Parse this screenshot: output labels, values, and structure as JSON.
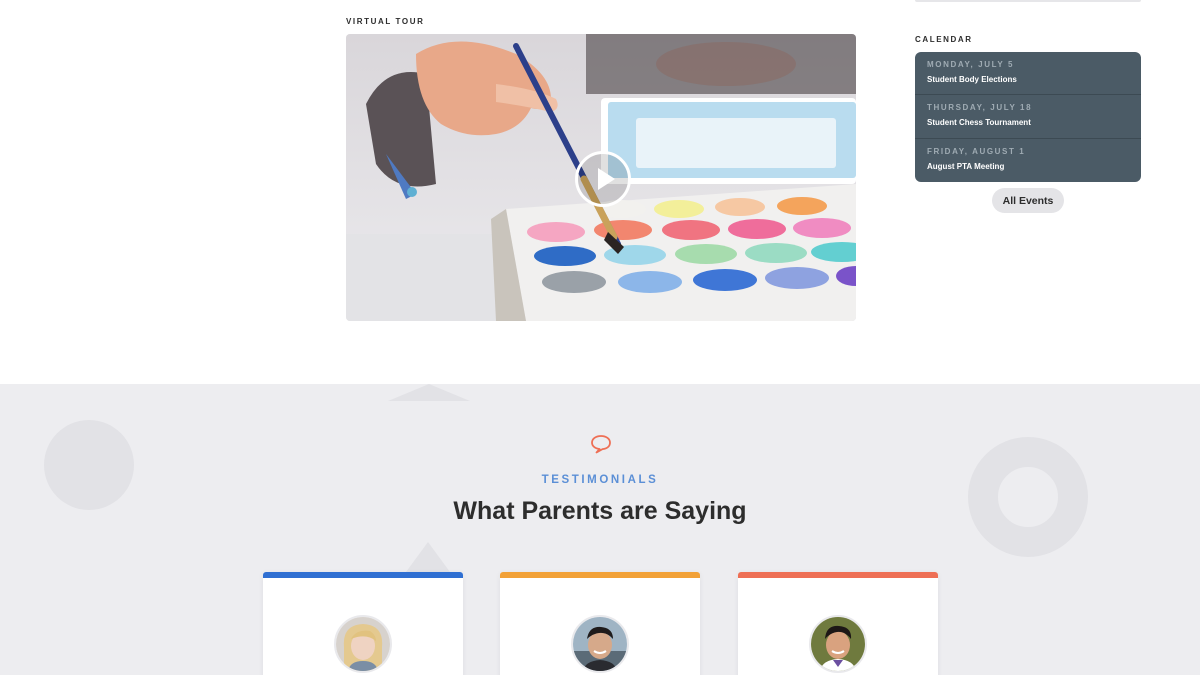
{
  "virtual_tour": {
    "label": "Virtual Tour",
    "play_icon": "play-icon"
  },
  "calendar": {
    "label": "Calendar",
    "events": [
      {
        "date": "Monday, July 5",
        "title": "Student Body Elections"
      },
      {
        "date": "Thursday, July 18",
        "title": "Student Chess Tournament"
      },
      {
        "date": "Friday, August 1",
        "title": "August PTA Meeting"
      }
    ],
    "all_events_label": "All Events",
    "background_color": "#4b5b66"
  },
  "testimonials": {
    "icon": "speech-bubble-icon",
    "eyebrow": "TESTIMONIALS",
    "heading": "What Parents are Saying",
    "accent_color": "#5b8fd6",
    "icon_color": "#ee6f55",
    "cards": [
      {
        "accent": "#2f6fd2"
      },
      {
        "accent": "#f2a137"
      },
      {
        "accent": "#ee6f55"
      }
    ]
  }
}
